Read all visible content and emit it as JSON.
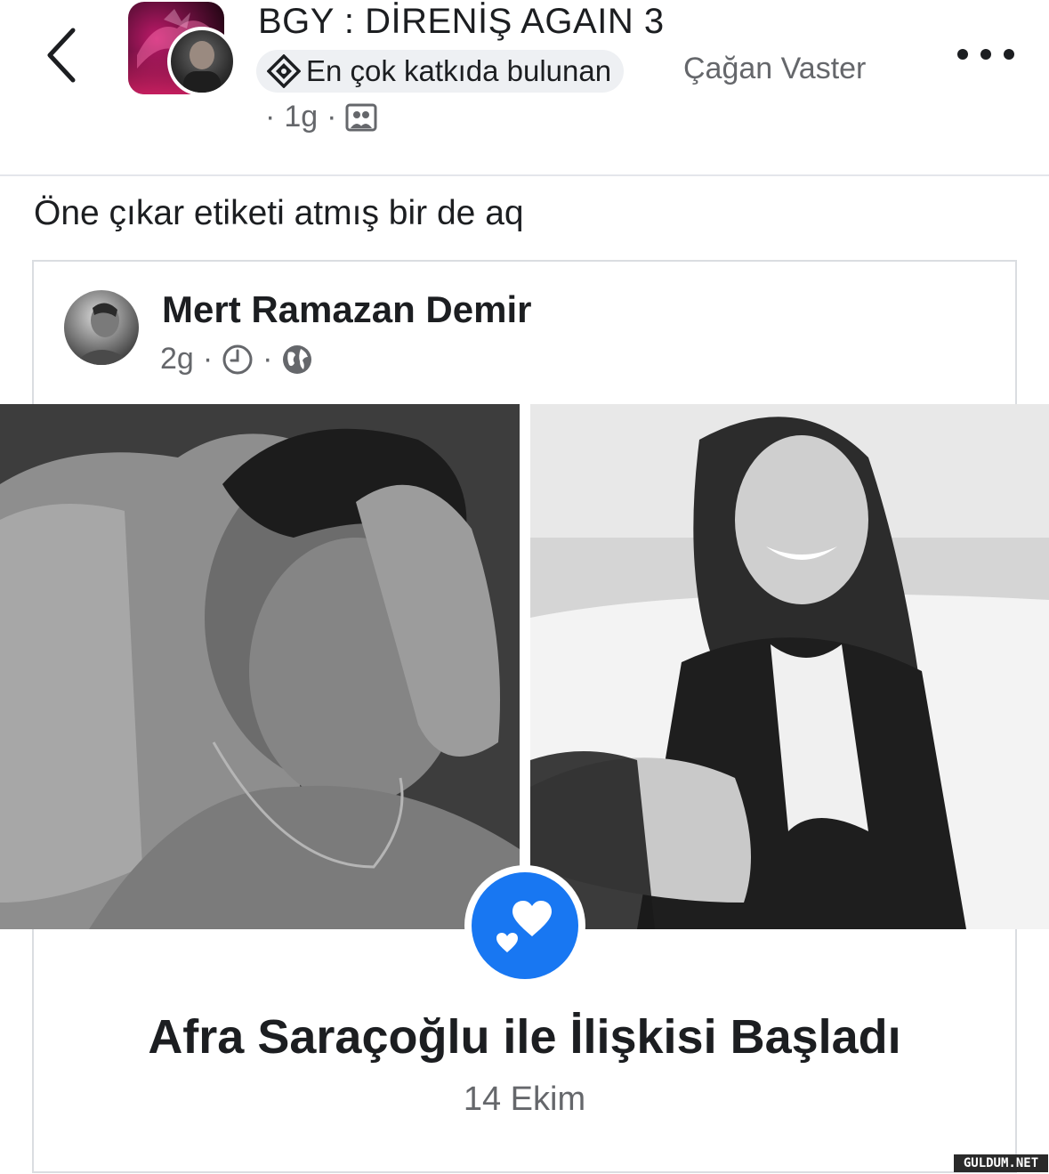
{
  "header": {
    "group_title": "BGY : DİRENİŞ AGAIN 3",
    "badge_label": "En çok katkıda bulunan",
    "author_name": "Çağan Vaster",
    "time_ago": "1g",
    "separator": "·",
    "icons": {
      "back": "chevron-left-icon",
      "badge": "top-contributor-icon",
      "audience": "group-members-icon",
      "more": "more-options-icon"
    }
  },
  "post": {
    "text": "Öne çıkar etiketi atmış bir de aq"
  },
  "shared_post": {
    "author_name": "Mert Ramazan Demir",
    "time_ago": "2g",
    "separator": "·",
    "icons": {
      "clock": "clock-icon",
      "audience": "globe-icon"
    }
  },
  "life_event": {
    "icon": "hearts-icon",
    "title": "Afra Saraçoğlu ile İlişkisi Başladı",
    "date": "14 Ekim"
  },
  "watermark": "GULDUM.NET",
  "colors": {
    "accent_blue": "#1877f2",
    "secondary_text": "#65676b",
    "primary_text": "#1c1e21"
  }
}
